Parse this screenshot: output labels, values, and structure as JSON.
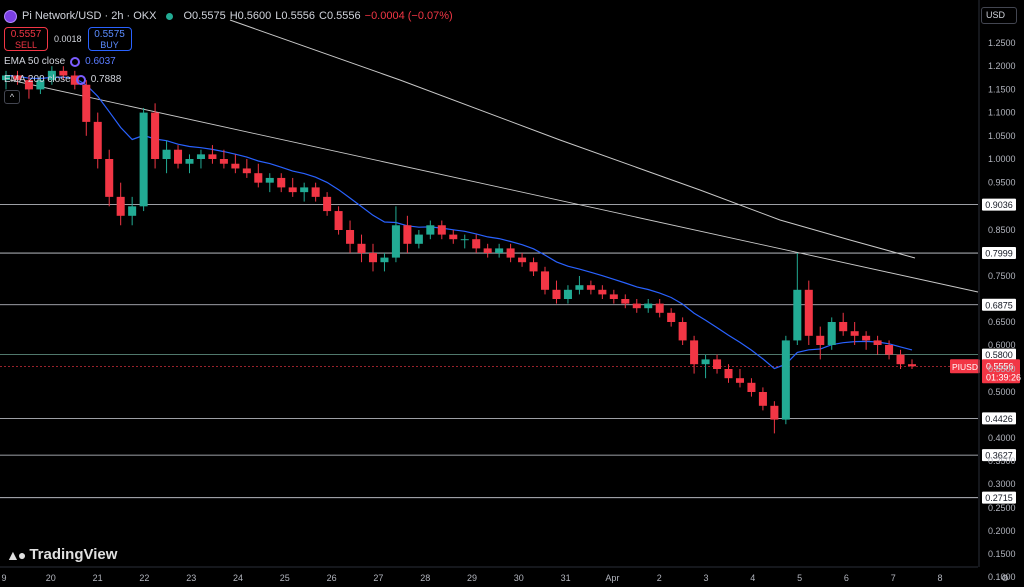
{
  "header": {
    "symbol": "Pi Network/USD · 2h · OKX",
    "open": "O0.5575",
    "high": "H0.5600",
    "low": "L0.5556",
    "close": "C0.5556",
    "change": "−0.0004 (−0.07%)"
  },
  "trade": {
    "sell_price": "0.5557",
    "sell_label": "SELL",
    "spread": "0.0018",
    "buy_price": "0.5575",
    "buy_label": "BUY"
  },
  "indicators": {
    "ema50_label": "EMA 50 close",
    "ema50_value": "0.6037",
    "ema200_label": "EMA 200 close",
    "ema200_value": "0.7888"
  },
  "currency_button": "USD",
  "brand": "TradingView",
  "colors": {
    "up": "#22ab94",
    "down": "#f23645",
    "ema50": "#2962ff",
    "ema200": "#c9c9c9",
    "background": "#000000"
  },
  "chart_data": {
    "type": "candlestick",
    "title": "",
    "y_axis_ticks": [
      "1.2500",
      "1.2000",
      "1.1500",
      "1.1000",
      "1.0500",
      "1.0000",
      "0.9500",
      "0.8500",
      "0.7500",
      "0.6500",
      "0.6000",
      "0.5500",
      "0.5000",
      "0.4000",
      "0.3500",
      "0.3000",
      "0.2500",
      "0.2000",
      "0.1500",
      "0.1000"
    ],
    "x_axis_ticks": [
      "9",
      "20",
      "21",
      "22",
      "23",
      "24",
      "25",
      "26",
      "27",
      "28",
      "29",
      "30",
      "31",
      "Apr",
      "2",
      "3",
      "4",
      "5",
      "6",
      "7",
      "8"
    ],
    "ylim": [
      0.08,
      1.3
    ],
    "horizontal_levels": [
      {
        "value": 0.9036,
        "label": "0.9036"
      },
      {
        "value": 0.7999,
        "label": "0.7999"
      },
      {
        "value": 0.6875,
        "label": "0.6875"
      },
      {
        "value": 0.58,
        "label": "0.5800"
      },
      {
        "value": 0.4426,
        "label": "0.4426"
      },
      {
        "value": 0.3627,
        "label": "0.3627"
      },
      {
        "value": 0.2715,
        "label": "0.2715"
      }
    ],
    "current_price": {
      "symbol": "PIUSD",
      "price": "0.5556",
      "countdown": "01:39:26"
    },
    "candles_ohlc": [
      [
        1.17,
        1.19,
        1.15,
        1.18
      ],
      [
        1.18,
        1.19,
        1.16,
        1.17
      ],
      [
        1.17,
        1.18,
        1.13,
        1.15
      ],
      [
        1.15,
        1.18,
        1.14,
        1.17
      ],
      [
        1.17,
        1.2,
        1.16,
        1.19
      ],
      [
        1.19,
        1.2,
        1.17,
        1.18
      ],
      [
        1.18,
        1.19,
        1.15,
        1.16
      ],
      [
        1.16,
        1.17,
        1.05,
        1.08
      ],
      [
        1.08,
        1.1,
        0.98,
        1.0
      ],
      [
        1.0,
        1.02,
        0.9,
        0.92
      ],
      [
        0.92,
        0.95,
        0.86,
        0.88
      ],
      [
        0.88,
        0.92,
        0.86,
        0.9
      ],
      [
        0.9,
        1.11,
        0.89,
        1.1
      ],
      [
        1.1,
        1.12,
        0.98,
        1.0
      ],
      [
        1.0,
        1.04,
        0.97,
        1.02
      ],
      [
        1.02,
        1.03,
        0.98,
        0.99
      ],
      [
        0.99,
        1.01,
        0.97,
        1.0
      ],
      [
        1.0,
        1.02,
        0.98,
        1.01
      ],
      [
        1.01,
        1.03,
        0.99,
        1.0
      ],
      [
        1.0,
        1.02,
        0.98,
        0.99
      ],
      [
        0.99,
        1.01,
        0.97,
        0.98
      ],
      [
        0.98,
        1.0,
        0.96,
        0.97
      ],
      [
        0.97,
        0.99,
        0.94,
        0.95
      ],
      [
        0.95,
        0.97,
        0.93,
        0.96
      ],
      [
        0.96,
        0.97,
        0.93,
        0.94
      ],
      [
        0.94,
        0.96,
        0.92,
        0.93
      ],
      [
        0.93,
        0.95,
        0.91,
        0.94
      ],
      [
        0.94,
        0.95,
        0.91,
        0.92
      ],
      [
        0.92,
        0.93,
        0.88,
        0.89
      ],
      [
        0.89,
        0.9,
        0.84,
        0.85
      ],
      [
        0.85,
        0.87,
        0.8,
        0.82
      ],
      [
        0.82,
        0.84,
        0.78,
        0.8
      ],
      [
        0.8,
        0.82,
        0.76,
        0.78
      ],
      [
        0.78,
        0.8,
        0.76,
        0.79
      ],
      [
        0.79,
        0.9,
        0.78,
        0.86
      ],
      [
        0.86,
        0.88,
        0.8,
        0.82
      ],
      [
        0.82,
        0.85,
        0.81,
        0.84
      ],
      [
        0.84,
        0.87,
        0.83,
        0.86
      ],
      [
        0.86,
        0.87,
        0.83,
        0.84
      ],
      [
        0.84,
        0.85,
        0.82,
        0.83
      ],
      [
        0.83,
        0.84,
        0.81,
        0.83
      ],
      [
        0.83,
        0.84,
        0.8,
        0.81
      ],
      [
        0.81,
        0.82,
        0.79,
        0.8
      ],
      [
        0.8,
        0.82,
        0.79,
        0.81
      ],
      [
        0.81,
        0.82,
        0.78,
        0.79
      ],
      [
        0.79,
        0.8,
        0.77,
        0.78
      ],
      [
        0.78,
        0.79,
        0.75,
        0.76
      ],
      [
        0.76,
        0.77,
        0.71,
        0.72
      ],
      [
        0.72,
        0.74,
        0.69,
        0.7
      ],
      [
        0.7,
        0.73,
        0.69,
        0.72
      ],
      [
        0.72,
        0.75,
        0.71,
        0.73
      ],
      [
        0.73,
        0.74,
        0.71,
        0.72
      ],
      [
        0.72,
        0.73,
        0.7,
        0.71
      ],
      [
        0.71,
        0.72,
        0.69,
        0.7
      ],
      [
        0.7,
        0.71,
        0.68,
        0.69
      ],
      [
        0.69,
        0.7,
        0.67,
        0.68
      ],
      [
        0.68,
        0.7,
        0.67,
        0.69
      ],
      [
        0.69,
        0.7,
        0.66,
        0.67
      ],
      [
        0.67,
        0.68,
        0.64,
        0.65
      ],
      [
        0.65,
        0.66,
        0.6,
        0.61
      ],
      [
        0.61,
        0.62,
        0.54,
        0.56
      ],
      [
        0.56,
        0.58,
        0.53,
        0.57
      ],
      [
        0.57,
        0.58,
        0.54,
        0.55
      ],
      [
        0.55,
        0.56,
        0.52,
        0.53
      ],
      [
        0.53,
        0.55,
        0.51,
        0.52
      ],
      [
        0.52,
        0.53,
        0.49,
        0.5
      ],
      [
        0.5,
        0.51,
        0.46,
        0.47
      ],
      [
        0.47,
        0.48,
        0.41,
        0.44
      ],
      [
        0.44,
        0.62,
        0.43,
        0.61
      ],
      [
        0.61,
        0.8,
        0.6,
        0.72
      ],
      [
        0.72,
        0.74,
        0.6,
        0.62
      ],
      [
        0.62,
        0.64,
        0.57,
        0.6
      ],
      [
        0.6,
        0.66,
        0.59,
        0.65
      ],
      [
        0.65,
        0.67,
        0.62,
        0.63
      ],
      [
        0.63,
        0.65,
        0.6,
        0.62
      ],
      [
        0.62,
        0.63,
        0.59,
        0.61
      ],
      [
        0.61,
        0.62,
        0.58,
        0.6
      ],
      [
        0.6,
        0.61,
        0.57,
        0.58
      ],
      [
        0.58,
        0.59,
        0.55,
        0.56
      ],
      [
        0.56,
        0.57,
        0.55,
        0.5556
      ]
    ]
  }
}
